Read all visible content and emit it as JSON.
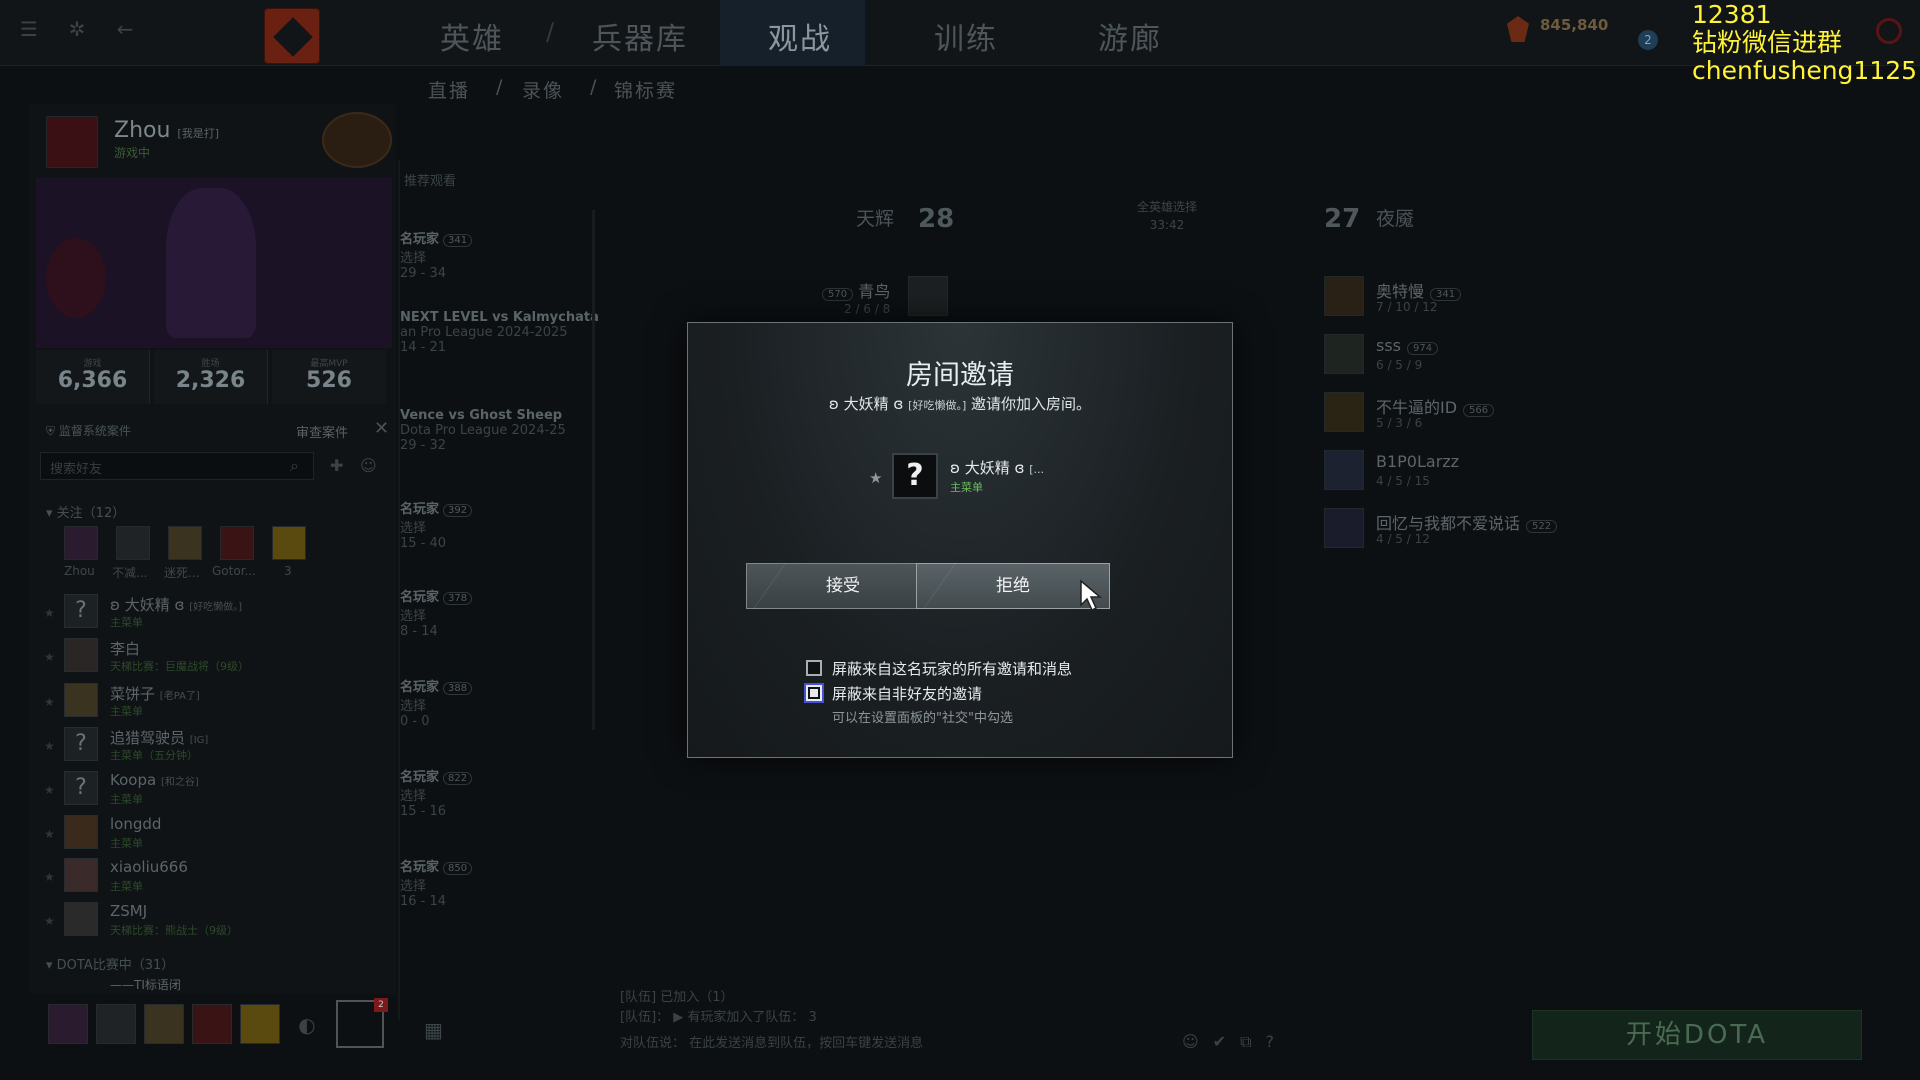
{
  "topbar": {
    "nav": [
      "英雄",
      "兵器库",
      "观战",
      "训练",
      "游廊"
    ],
    "active_nav": "观战",
    "shards": "845,840",
    "level_badge": "2"
  },
  "subnav": [
    "直播",
    "录像",
    "锦标赛"
  ],
  "profile": {
    "name": "Zhou",
    "tag": "[我是打]",
    "status": "游戏中",
    "stats": [
      {
        "label": "游戏",
        "value": "6,366"
      },
      {
        "label": "胜场",
        "value": "2,326"
      },
      {
        "label": "最高MVP",
        "value": "526"
      }
    ],
    "cases": "监督系统案件",
    "review_cases": "审查案件",
    "search_placeholder": "搜索好友"
  },
  "favorites": {
    "header": "关注（12）",
    "items": [
      "Zhou",
      "不减...",
      "迷死...",
      "Gotor...",
      "3"
    ]
  },
  "friends": [
    {
      "name": "ʚ 大妖精 ɞ",
      "tag": "[好吃懒做。]",
      "status": "主菜单",
      "avatar": "?"
    },
    {
      "name": "李白",
      "tag": "",
      "status": "天梯比赛：巨魔战将（9级）",
      "avatar": ""
    },
    {
      "name": "菜饼子",
      "tag": "[老PA了]",
      "status": "主菜单",
      "avatar": ""
    },
    {
      "name": "追猎驾驶员",
      "tag": "[IG]",
      "status": "主菜单（五分钟）",
      "avatar": "?"
    },
    {
      "name": "Koopa",
      "tag": "[和之谷]",
      "status": "主菜单",
      "avatar": "?"
    },
    {
      "name": "longdd",
      "tag": "",
      "status": "主菜单",
      "avatar": ""
    },
    {
      "name": "xiaoliu666",
      "tag": "",
      "status": "主菜单",
      "avatar": ""
    },
    {
      "name": "ZSMJ",
      "tag": "",
      "status": "天梯比赛：熊战士（9级）",
      "avatar": ""
    }
  ],
  "dota_group": {
    "header": "DOTA比赛中（31）",
    "first": "——TI标语闭"
  },
  "matches": [
    {
      "line1": "名玩家",
      "badge": "341",
      "line2": "选择",
      "line3": "29 - 34"
    },
    {
      "line1": "NEXT LEVEL vs Kalmychata",
      "badge": "",
      "line2": "an Pro League 2024-2025",
      "line3": "14 - 21"
    },
    {
      "line1": "Vence vs Ghost Sheep",
      "badge": "",
      "line2": "Dota Pro League 2024-25",
      "line3": "29 - 32"
    },
    {
      "line1": "名玩家",
      "badge": "392",
      "line2": "选择",
      "line3": "15 - 40"
    },
    {
      "line1": "名玩家",
      "badge": "378",
      "line2": "选择",
      "line3": "8 - 14"
    },
    {
      "line1": "名玩家",
      "badge": "388",
      "line2": "选择",
      "line3": "0 - 0"
    },
    {
      "line1": "名玩家",
      "badge": "822",
      "line2": "选择",
      "line3": "15 - 16"
    },
    {
      "line1": "名玩家",
      "badge": "850",
      "line2": "选择",
      "line3": "16 - 14"
    }
  ],
  "match_header": "推荐观看",
  "scoreboard": {
    "radiant": "天辉",
    "radiant_score": "28",
    "dire": "夜魇",
    "dire_score": "27",
    "mode": "全英雄选择",
    "time": "33:42",
    "radiant_players": [
      {
        "name": "青鸟",
        "badge": "570",
        "kda": "2 / 6 / 8"
      }
    ],
    "dire_players": [
      {
        "name": "奥特慢",
        "badge": "341",
        "kda": "7 / 10 / 12"
      },
      {
        "name": "sss",
        "badge": "974",
        "kda": "6 / 5 / 9"
      },
      {
        "name": "不牛逼的ID",
        "badge": "566",
        "kda": "5 / 3 / 6"
      },
      {
        "name": "B1P0Larzz",
        "badge": "",
        "kda": "4 / 5 / 15"
      },
      {
        "name": "回忆与我都不爱说话",
        "badge": "522",
        "kda": "4 / 5 / 12"
      }
    ]
  },
  "chat": [
    "[队伍] 已加入（1）",
    "[队伍]： ▶ 有玩家加入了队伍： 3",
    "对队伍说：  在此发送消息到队伍，按回车键发送消息"
  ],
  "play_button": "开始DOTA",
  "overlay": {
    "line1": "12381",
    "line2": "钻粉微信进群",
    "line3": "chenfusheng1125"
  },
  "modal": {
    "title": "房间邀请",
    "inviter_prefix": "ʚ 大妖精 ɞ",
    "inviter_tag": "[好吃懒做。]",
    "invite_text": "邀请你加入房间。",
    "card_name": "ʚ 大妖精 ɞ",
    "card_tag": "[...",
    "card_status": "主菜单",
    "avatar_glyph": "?",
    "accept": "接受",
    "decline": "拒绝",
    "checkbox1": "屏蔽来自这名玩家的所有邀请和消息",
    "checkbox2": "屏蔽来自非好友的邀请",
    "hint": "可以在设置面板的\"社交\"中勾选"
  }
}
